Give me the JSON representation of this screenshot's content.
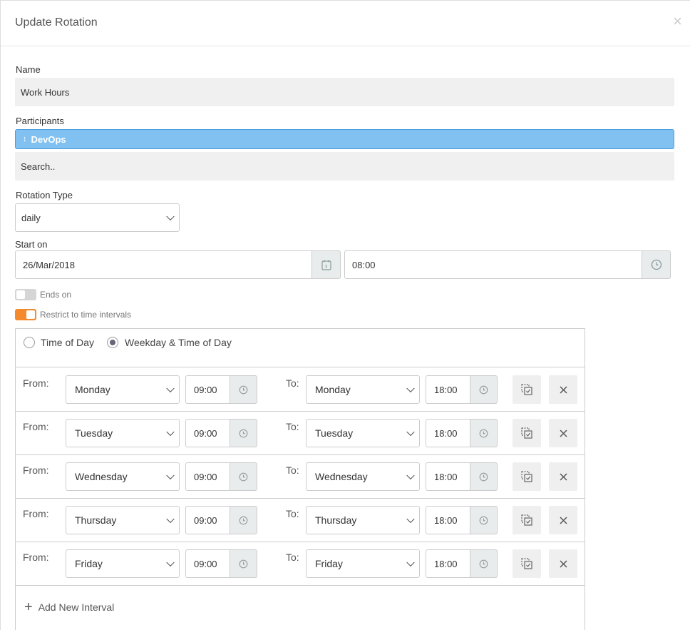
{
  "dialog": {
    "title": "Update Rotation",
    "close": "×"
  },
  "name": {
    "label": "Name",
    "value": "Work Hours"
  },
  "participants": {
    "label": "Participants",
    "chip": "DevOps",
    "chip_handle": "↕",
    "search_placeholder": "Search.."
  },
  "rotation_type": {
    "label": "Rotation Type",
    "value": "daily"
  },
  "start_on": {
    "label": "Start on",
    "date": "26/Mar/2018",
    "time": "08:00"
  },
  "ends_on": {
    "label": "Ends on",
    "enabled": false
  },
  "restrict": {
    "label": "Restrict to time intervals",
    "enabled": true
  },
  "mode": {
    "option1": "Time of Day",
    "option2": "Weekday & Time of Day",
    "selected": "Weekday & Time of Day"
  },
  "intervals": {
    "from_label": "From:",
    "to_label": "To:",
    "rows": [
      {
        "from_day": "Monday",
        "from_time": "09:00",
        "to_day": "Monday",
        "to_time": "18:00"
      },
      {
        "from_day": "Tuesday",
        "from_time": "09:00",
        "to_day": "Tuesday",
        "to_time": "18:00"
      },
      {
        "from_day": "Wednesday",
        "from_time": "09:00",
        "to_day": "Wednesday",
        "to_time": "18:00"
      },
      {
        "from_day": "Thursday",
        "from_time": "09:00",
        "to_day": "Thursday",
        "to_time": "18:00"
      },
      {
        "from_day": "Friday",
        "from_time": "09:00",
        "to_day": "Friday",
        "to_time": "18:00"
      }
    ],
    "add_label": "Add New Interval"
  },
  "colors": {
    "accent_orange": "#f5892e",
    "chip_blue": "#80c1f1"
  }
}
